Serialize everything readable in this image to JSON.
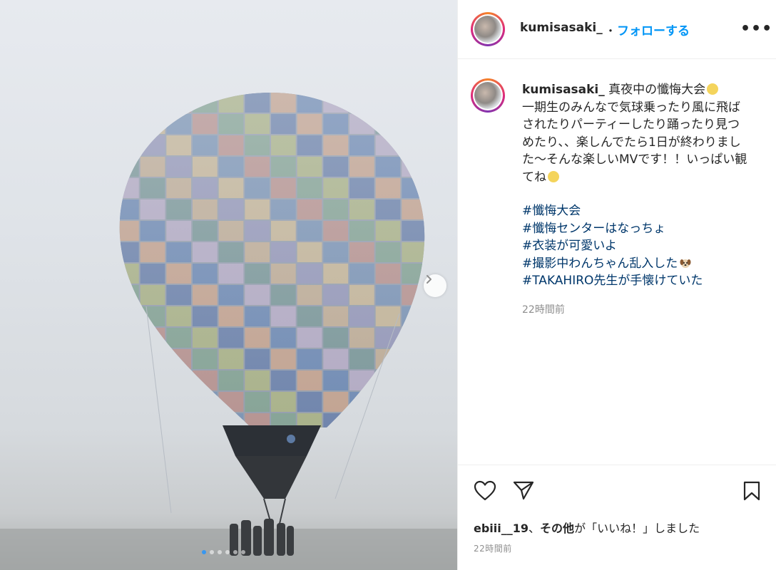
{
  "post": {
    "username": "kumisasaki_",
    "separator": "・",
    "follow_label": "フォローする",
    "more_label": "•••"
  },
  "caption": {
    "username": "kumisasaki_",
    "line1": "真夜中の懺悔大会",
    "body": "一期生のみんなで気球乗ったり風に飛ばされたりパーティーしたり踊ったり見つめたり、、楽しんでたら1日が終わりました〜そんな楽しいMVです！！いっぱい観てね",
    "hashtags": [
      "#懺悔大会",
      "#懺悔センターはなっちょ",
      "#衣装が可愛いよ",
      "#撮影中わんちゃん乱入した",
      "#TAKAHIRO先生が手懐けていた"
    ],
    "timestamp": "22時間前"
  },
  "carousel": {
    "slide_count": 6,
    "active_index": 0
  },
  "actions": {
    "like_icon": "heart-icon",
    "share_icon": "send-icon",
    "save_icon": "bookmark-icon"
  },
  "likes": {
    "user": "ebiii__19",
    "rest_prefix": "、",
    "others": "その他",
    "suffix": "が「いいね！」しました"
  },
  "footer_timestamp": "22時間前"
}
